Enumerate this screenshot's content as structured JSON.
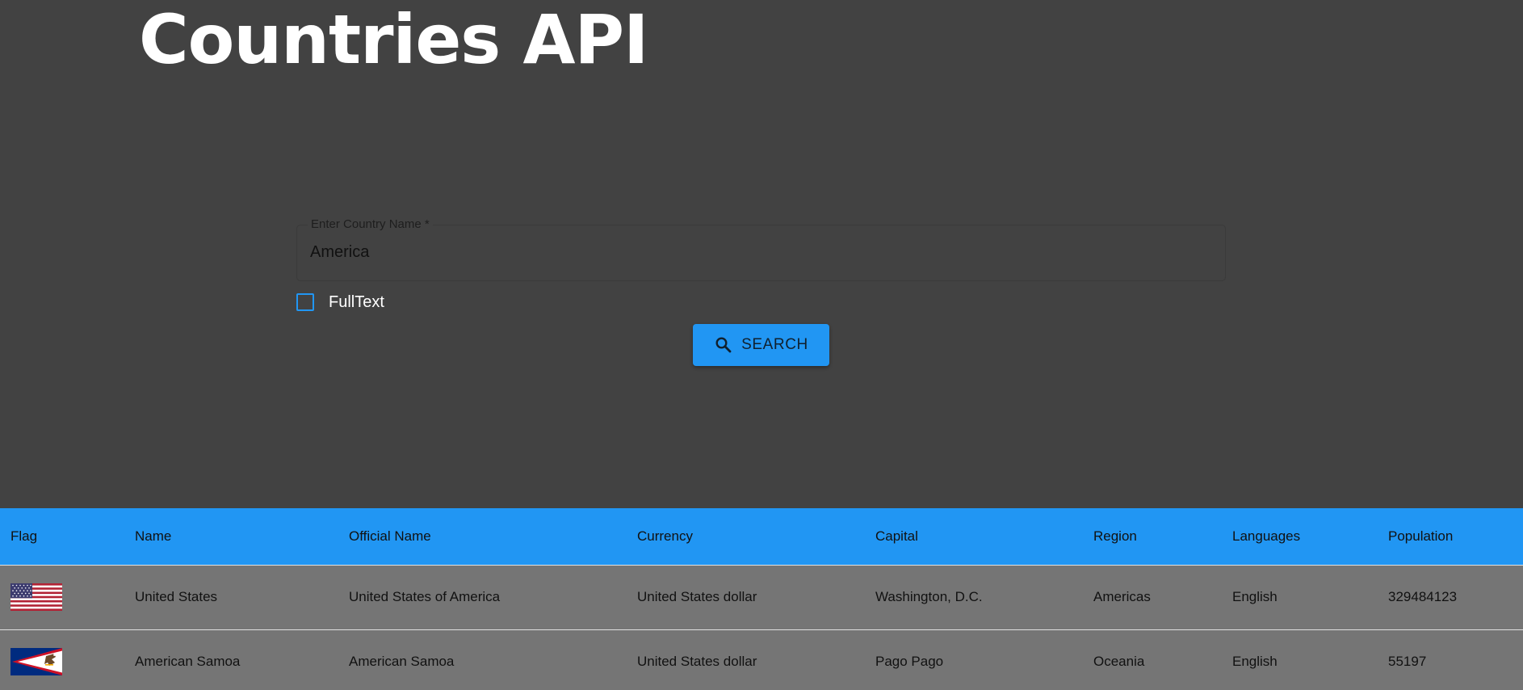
{
  "header": {
    "title": "Countries API"
  },
  "search": {
    "label": "Enter Country Name *",
    "value": "America",
    "fulltext_label": "FullText",
    "fulltext_checked": false,
    "button_label": "SEARCH",
    "button_icon": "search-icon"
  },
  "colors": {
    "background": "#424242",
    "accent": "#2196f3",
    "row_background": "#757575"
  },
  "table": {
    "columns": [
      "Flag",
      "Name",
      "Official Name",
      "Currency",
      "Capital",
      "Region",
      "Languages",
      "Population"
    ],
    "rows": [
      {
        "flag": "united-states-flag",
        "name": "United States",
        "official_name": "United States of America",
        "currency": "United States dollar",
        "capital": "Washington, D.C.",
        "region": "Americas",
        "languages": "English",
        "population": "329484123"
      },
      {
        "flag": "american-samoa-flag",
        "name": "American Samoa",
        "official_name": "American Samoa",
        "currency": "United States dollar",
        "capital": "Pago Pago",
        "region": "Oceania",
        "languages": "English",
        "population": "55197"
      }
    ]
  }
}
